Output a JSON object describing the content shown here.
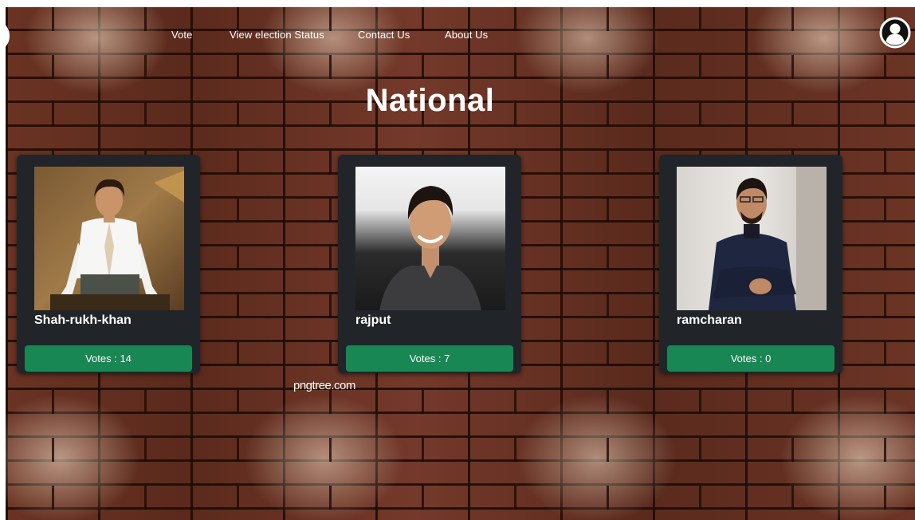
{
  "nav": {
    "items": [
      {
        "label": "Vote"
      },
      {
        "label": "View election Status"
      },
      {
        "label": "Contact Us"
      },
      {
        "label": "About Us"
      }
    ],
    "profile_icon": "user-circle-icon"
  },
  "page": {
    "title": "National"
  },
  "candidates": [
    {
      "name": "Shah-rukh-khan",
      "votes_label": "Votes : 14",
      "votes": 14
    },
    {
      "name": "rajput",
      "votes_label": "Votes : 7",
      "votes": 7
    },
    {
      "name": "ramcharan",
      "votes_label": "Votes : 0",
      "votes": 0
    }
  ],
  "watermark": "pngtree.com",
  "colors": {
    "card_bg": "#212529",
    "button_bg": "#198754",
    "text": "#ffffff"
  }
}
